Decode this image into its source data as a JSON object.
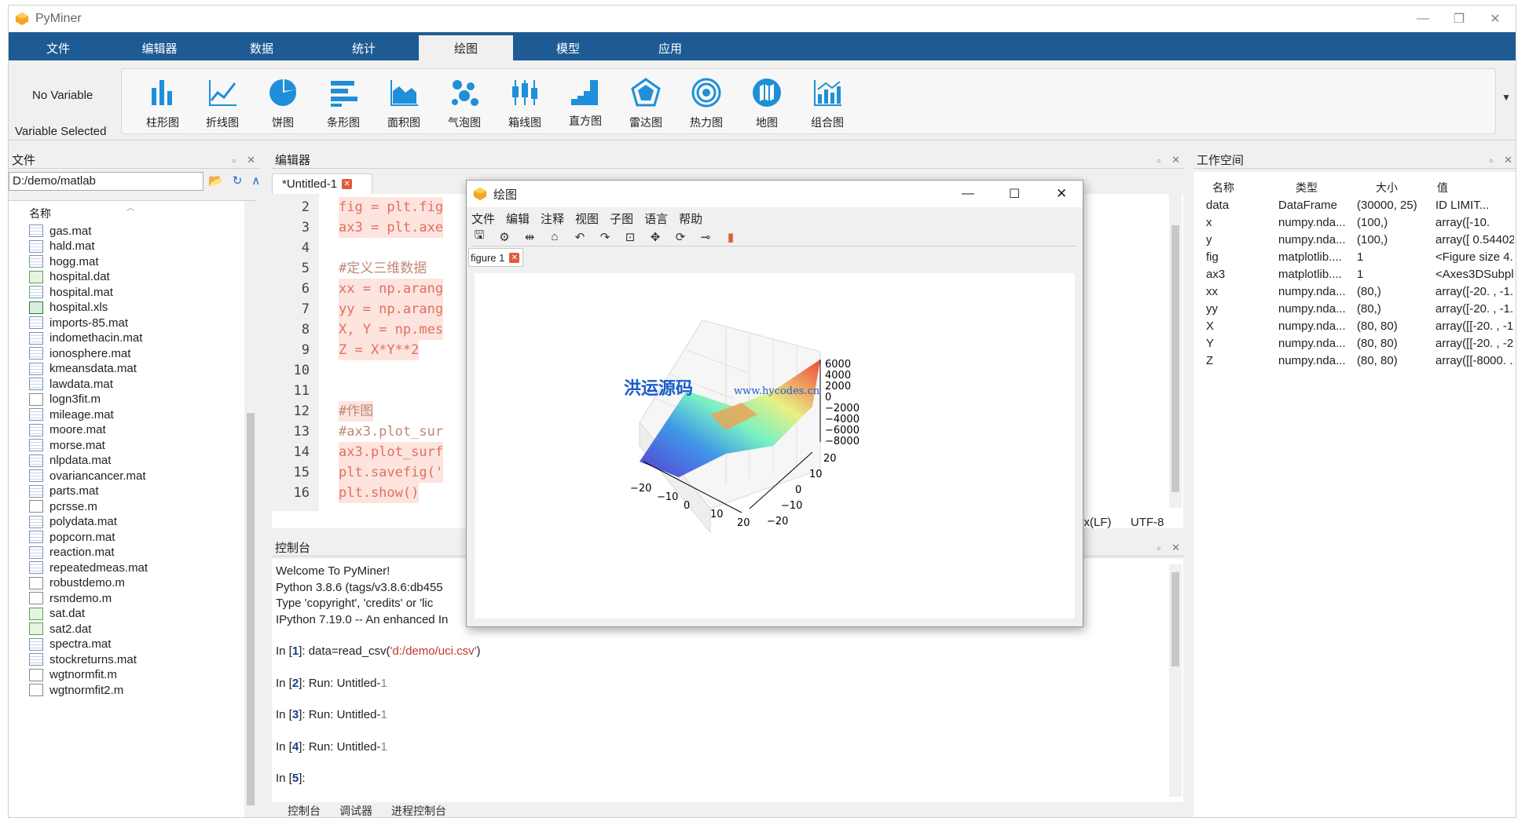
{
  "app": {
    "title": "PyMiner",
    "accent": "#1e5b94"
  },
  "window_controls": {
    "minimize": "—",
    "maximize": "❐",
    "close": "✕"
  },
  "menu": {
    "tabs": [
      "文件",
      "编辑器",
      "数据",
      "统计",
      "绘图",
      "模型",
      "应用"
    ],
    "active": "绘图"
  },
  "ribbon": {
    "no_variable": "No Variable",
    "variable_selected": "Variable Selected",
    "buttons": [
      "柱形图",
      "折线图",
      "饼图",
      "条形图",
      "面积图",
      "气泡图",
      "箱线图",
      "直方图",
      "雷达图",
      "热力图",
      "地图",
      "组合图"
    ]
  },
  "files": {
    "title": "文件",
    "path": "D:/demo/matlab",
    "column": "名称",
    "items": [
      {
        "name": "gas.mat",
        "type": "mat"
      },
      {
        "name": "hald.mat",
        "type": "mat"
      },
      {
        "name": "hogg.mat",
        "type": "mat"
      },
      {
        "name": "hospital.dat",
        "type": "dat"
      },
      {
        "name": "hospital.mat",
        "type": "mat"
      },
      {
        "name": "hospital.xls",
        "type": "xls"
      },
      {
        "name": "imports-85.mat",
        "type": "mat"
      },
      {
        "name": "indomethacin.mat",
        "type": "mat"
      },
      {
        "name": "ionosphere.mat",
        "type": "mat"
      },
      {
        "name": "kmeansdata.mat",
        "type": "mat"
      },
      {
        "name": "lawdata.mat",
        "type": "mat"
      },
      {
        "name": "logn3fit.m",
        "type": "doc"
      },
      {
        "name": "mileage.mat",
        "type": "mat"
      },
      {
        "name": "moore.mat",
        "type": "mat"
      },
      {
        "name": "morse.mat",
        "type": "mat"
      },
      {
        "name": "nlpdata.mat",
        "type": "mat"
      },
      {
        "name": "ovariancancer.mat",
        "type": "mat"
      },
      {
        "name": "parts.mat",
        "type": "mat"
      },
      {
        "name": "pcrsse.m",
        "type": "doc"
      },
      {
        "name": "polydata.mat",
        "type": "mat"
      },
      {
        "name": "popcorn.mat",
        "type": "mat"
      },
      {
        "name": "reaction.mat",
        "type": "mat"
      },
      {
        "name": "repeatedmeas.mat",
        "type": "mat"
      },
      {
        "name": "robustdemo.m",
        "type": "doc"
      },
      {
        "name": "rsmdemo.m",
        "type": "doc"
      },
      {
        "name": "sat.dat",
        "type": "dat"
      },
      {
        "name": "sat2.dat",
        "type": "dat"
      },
      {
        "name": "spectra.mat",
        "type": "mat"
      },
      {
        "name": "stockreturns.mat",
        "type": "mat"
      },
      {
        "name": "wgtnormfit.m",
        "type": "doc"
      },
      {
        "name": "wgtnormfit2.m",
        "type": "doc"
      }
    ]
  },
  "editor": {
    "title": "编辑器",
    "tab": "*Untitled-1",
    "lines": [
      {
        "n": "2",
        "code": "fig = plt.fig",
        "hl": true,
        "cmt": false
      },
      {
        "n": "3",
        "code": "ax3 = plt.axe",
        "hl": true,
        "cmt": false
      },
      {
        "n": "4",
        "code": "",
        "hl": false,
        "cmt": false
      },
      {
        "n": "5",
        "code": "#定义三维数据",
        "hl": false,
        "cmt": true
      },
      {
        "n": "6",
        "code": "xx = np.arang",
        "hl": true,
        "cmt": false
      },
      {
        "n": "7",
        "code": "yy = np.arang",
        "hl": true,
        "cmt": false
      },
      {
        "n": "8",
        "code": "X, Y = np.mes",
        "hl": true,
        "cmt": false
      },
      {
        "n": "9",
        "code": "Z = X*Y**2",
        "hl": true,
        "cmt": false
      },
      {
        "n": "10",
        "code": "",
        "hl": false,
        "cmt": false
      },
      {
        "n": "11",
        "code": "",
        "hl": false,
        "cmt": false
      },
      {
        "n": "12",
        "code": "#作图",
        "hl": true,
        "cmt": true
      },
      {
        "n": "13",
        "code": "#ax3.plot_sur",
        "hl": false,
        "cmt": true
      },
      {
        "n": "14",
        "code": "ax3.plot_surf",
        "hl": true,
        "cmt": false
      },
      {
        "n": "15",
        "code": "plt.savefig('",
        "hl": true,
        "cmt": false
      },
      {
        "n": "16",
        "code": "plt.show()",
        "hl": true,
        "cmt": false
      }
    ],
    "status": {
      "eol": "Unix(LF)",
      "encoding": "UTF-8"
    }
  },
  "console": {
    "title": "控制台",
    "banner": [
      "Welcome To PyMiner!",
      "Python 3.8.6 (tags/v3.8.6:db455",
      "Type 'copyright', 'credits' or 'lic",
      "IPython 7.19.0 -- An enhanced In"
    ],
    "prompts": [
      {
        "label": "In [",
        "num": "1",
        "close": "]: ",
        "cmd": "data=read_csv(",
        "arg": "'d:/demo/uci.csv'",
        "tail": ")"
      },
      {
        "label": "In [",
        "num": "2",
        "close": "]: ",
        "cmd": "Run: Untitled-",
        "arg": "1",
        "tail": ""
      },
      {
        "label": "In [",
        "num": "3",
        "close": "]: ",
        "cmd": "Run: Untitled-",
        "arg": "1",
        "tail": ""
      },
      {
        "label": "In [",
        "num": "4",
        "close": "]: ",
        "cmd": "Run: Untitled-",
        "arg": "1",
        "tail": ""
      },
      {
        "label": "In [",
        "num": "5",
        "close": "]: ",
        "cmd": "",
        "arg": "",
        "tail": ""
      }
    ],
    "bottom_tabs": [
      "控制台",
      "调试器",
      "进程控制台"
    ]
  },
  "workspace": {
    "title": "工作空间",
    "columns": [
      "名称",
      "类型",
      "大小",
      "值"
    ],
    "rows": [
      {
        "name": "data",
        "type": "DataFrame",
        "size": "(30000, 25)",
        "value": "   ID  LIMIT..."
      },
      {
        "name": "x",
        "type": "numpy.nda...",
        "size": "(100,)",
        "value": "array([-10."
      },
      {
        "name": "y",
        "type": "numpy.nda...",
        "size": "(100,)",
        "value": "array([ 0.54402"
      },
      {
        "name": "fig",
        "type": "matplotlib....",
        "size": "1",
        "value": "<Figure size 4..."
      },
      {
        "name": "ax3",
        "type": "matplotlib....",
        "size": "1",
        "value": "<Axes3DSubpl..."
      },
      {
        "name": "xx",
        "type": "numpy.nda...",
        "size": "(80,)",
        "value": "array([-20. , -1..."
      },
      {
        "name": "yy",
        "type": "numpy.nda...",
        "size": "(80,)",
        "value": "array([-20. , -1..."
      },
      {
        "name": "X",
        "type": "numpy.nda...",
        "size": "(80, 80)",
        "value": "array([[-20. , -1..."
      },
      {
        "name": "Y",
        "type": "numpy.nda...",
        "size": "(80, 80)",
        "value": "array([[-20. , -2..."
      },
      {
        "name": "Z",
        "type": "numpy.nda...",
        "size": "(80, 80)",
        "value": "array([[-8000. ..."
      }
    ]
  },
  "figure": {
    "title": "绘图",
    "menu": [
      "文件",
      "编辑",
      "注释",
      "视图",
      "子图",
      "语言",
      "帮助"
    ],
    "tab": "figure 1",
    "watermark_cn": "洪运源码",
    "watermark_url": "www.hycodes.cn",
    "z_ticks": [
      "6000",
      "4000",
      "2000",
      "0",
      "−2000",
      "−4000",
      "−6000",
      "−8000"
    ],
    "x_ticks": [
      "−20",
      "−10",
      "0",
      "10",
      "20"
    ],
    "y_ticks": [
      "20",
      "10",
      "0",
      "−10",
      "−20"
    ]
  }
}
